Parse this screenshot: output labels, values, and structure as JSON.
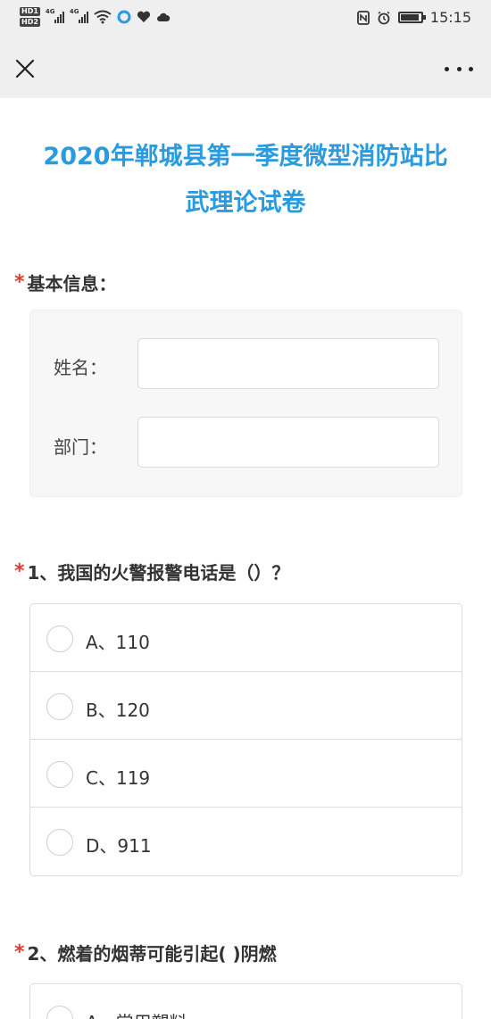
{
  "status_bar": {
    "left": {
      "hd1": "HD1",
      "hd2": "HD2",
      "net1": "4G",
      "net2": "4G"
    },
    "time": "15:15"
  },
  "nav": {
    "close_icon": "close-icon",
    "more_icon": "more-icon"
  },
  "page": {
    "title_line1": "2020年郸城县第一季度微型消防站比",
    "title_line2": "武理论试卷"
  },
  "basic_info": {
    "required_mark": "*",
    "label": "基本信息：",
    "fields": [
      {
        "label": "姓名：",
        "value": ""
      },
      {
        "label": "部门：",
        "value": ""
      }
    ]
  },
  "questions": [
    {
      "required_mark": "*",
      "label": "1、我国的火警报警电话是（）？",
      "options": [
        "A、110",
        "B、120",
        "C、119",
        "D、911"
      ]
    },
    {
      "required_mark": "*",
      "label": "2、燃着的烟蒂可能引起( )阴燃",
      "options": [
        "A、常用塑料"
      ]
    }
  ]
}
